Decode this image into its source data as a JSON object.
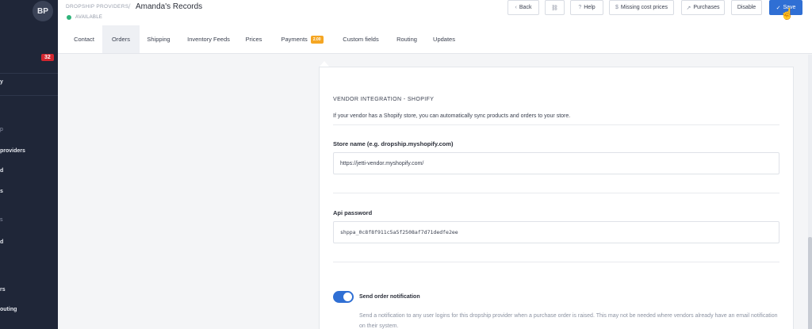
{
  "sidebar": {
    "avatar": "BP",
    "badge": "32",
    "items": [
      {
        "label": "y"
      },
      {
        "label": "p"
      },
      {
        "label": "providers"
      },
      {
        "label": "d"
      },
      {
        "label": "s"
      },
      {
        "label": "s"
      },
      {
        "label": "d"
      },
      {
        "label": "rs"
      },
      {
        "label": "outing"
      }
    ]
  },
  "header": {
    "breadcrumb": "DROPSHIP PROVIDERS",
    "separator": "/",
    "title": "Amanda's Records",
    "status": "AVAILABLE",
    "buttons": {
      "back": "Back",
      "help": "Help",
      "missing_cost": "Missing cost prices",
      "purchases": "Purchases",
      "disable": "Disable",
      "save": "Save"
    }
  },
  "tabs": [
    {
      "label": "Contact"
    },
    {
      "label": "Orders"
    },
    {
      "label": "Shipping"
    },
    {
      "label": "Inventory Feeds"
    },
    {
      "label": "Prices"
    },
    {
      "label": "Payments",
      "badge": "2.00"
    },
    {
      "label": "Custom fields"
    },
    {
      "label": "Routing"
    },
    {
      "label": "Updates"
    }
  ],
  "integration": {
    "title": "VENDOR INTEGRATION - SHOPIFY",
    "description": "If your vendor has a Shopify store, you can automatically sync products and orders to your store.",
    "store_label": "Store name (e.g. dropship.myshopify.com)",
    "store_value": "https://jetti-vendor.myshopify.com/",
    "api_label": "Api password",
    "api_value": "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",
    "toggle_label": "Send order notification",
    "toggle_on": true,
    "toggle_desc": "Send a notification to any user logins for this dropship provider when a purchase order is raised. This may not be needed where vendors already have an email notification on their system."
  },
  "colors": {
    "sidebar": "#1f2638",
    "primary": "#2f6fd4",
    "badge_red": "#d3262f",
    "badge_orange": "#f5a623",
    "status_green": "#2fb37a"
  }
}
